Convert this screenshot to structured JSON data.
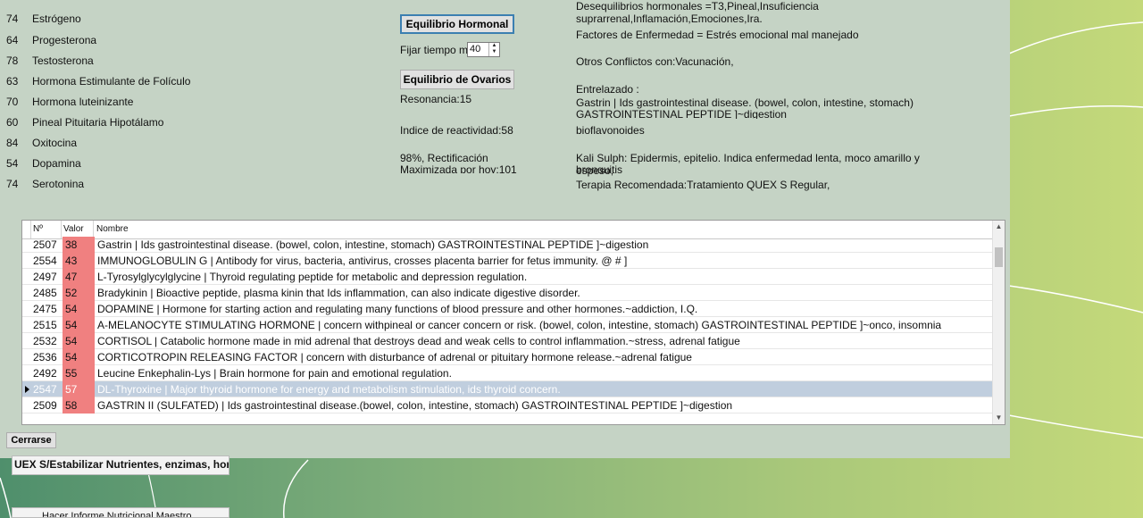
{
  "hormones": [
    {
      "value": "74",
      "name": "Estrógeno"
    },
    {
      "value": "64",
      "name": "Progesterona"
    },
    {
      "value": "78",
      "name": "Testosterona"
    },
    {
      "value": "63",
      "name": "Hormona Estimulante de Folículo"
    },
    {
      "value": "70",
      "name": "Hormona luteinizante"
    },
    {
      "value": "60",
      "name": "Pineal Pituitaria Hipotálamo"
    },
    {
      "value": "84",
      "name": "Oxitocina"
    },
    {
      "value": "54",
      "name": "Dopamina"
    },
    {
      "value": "74",
      "name": "Serotonina"
    }
  ],
  "controls": {
    "equilibrio_hormonal": "Equilibrio Hormonal",
    "fijar_tiempo_label": "Fijar tiempo mi",
    "fijar_tiempo_value": "40",
    "equilibrio_ovarios": "Equilibrio de Ovarios",
    "resonancia": "Resonancia:15",
    "indice": "Indice de reactividad:58",
    "rectificacion_1": "98%, Rectificación",
    "rectificacion_2": "Maximizada por hoy:101"
  },
  "info": {
    "desequilibrios_1": "Desequilibrios hormonales =T3,Pineal,Insuficiencia",
    "desequilibrios_2": "suprarrenal,Inflamación,Emociones,Ira.",
    "factores": "Factores de Enfermedad = Estrés emocional mal manejado",
    "otros": "Otros Conflictos con:Vacunación,",
    "entrelazado": "Entrelazado :",
    "entrelazado_1": "Gastrin | Ids gastrointestinal disease. (bowel, colon, intestine, stomach)",
    "entrelazado_2": "GASTROINTESTINAL PEPTIDE  ]~digestion",
    "bioflavonoides": "bioflavonoides",
    "kali_1": "Kali Sulph: Epidermis, epitelio. Indica enfermedad lenta, moco amarillo y espeso,",
    "kali_2": "bronquitis",
    "terapia": "Terapia Recomendada:Tratamiento QUEX S Regular,"
  },
  "grid": {
    "headers": {
      "no": "Nº",
      "valor": "Valor",
      "nombre": "Nombre"
    },
    "rows": [
      {
        "no": "2507",
        "valor": "38",
        "nombre": "Gastrin | Ids gastrointestinal disease. (bowel, colon, intestine, stomach) GASTROINTESTINAL PEPTIDE  ]~digestion"
      },
      {
        "no": "2554",
        "valor": "43",
        "nombre": "IMMUNOGLOBULIN G | Antibody for virus, bacteria, antivirus, crosses placenta barrier for fetus immunity. @ # ]"
      },
      {
        "no": "2497",
        "valor": "47",
        "nombre": "L-Tyrosylglycylglycine | Thyroid regulating peptide for metabolic and depression regulation."
      },
      {
        "no": "2485",
        "valor": "52",
        "nombre": "Bradykinin | Bioactive peptide, plasma kinin that Ids inflammation, can also indicate digestive disorder."
      },
      {
        "no": "2475",
        "valor": "54",
        "nombre": "DOPAMINE | Hormone for starting action and regulating many functions of blood pressure and other hormones.~addiction, I.Q."
      },
      {
        "no": "2515",
        "valor": "54",
        "nombre": "A-MELANOCYTE STIMULATING HORMONE | concern withpineal or cancer concern or risk. (bowel, colon, intestine, stomach) GASTROINTESTINAL PEPTIDE  ]~onco, insomnia"
      },
      {
        "no": "2532",
        "valor": "54",
        "nombre": "CORTISOL | Catabolic hormone made in mid adrenal that destroys dead and weak cells to control inflammation.~stress, adrenal fatigue"
      },
      {
        "no": "2536",
        "valor": "54",
        "nombre": "CORTICOTROPIN RELEASING FACTOR | concern with disturbance of adrenal or pituitary hormone release.~adrenal fatigue"
      },
      {
        "no": "2492",
        "valor": "55",
        "nombre": "Leucine Enkephalin-Lys | Brain hormone for pain and emotional regulation."
      },
      {
        "no": "2547",
        "valor": "57",
        "nombre": "DL-Thyroxine | Major thyroid hormone for energy and metabolism stimulation, ids thyroid concern.",
        "selected": true
      },
      {
        "no": "2509",
        "valor": "58",
        "nombre": "GASTRIN II (SULFATED) | Ids gastrointestinal disease.(bowel, colon, intestine, stomach) GASTROINTESTINAL PEPTIDE  ]~digestion"
      }
    ]
  },
  "cerrarse": "Cerrarse",
  "background_buttons": {
    "estabilizar": "UEX S/Estabilizar Nutrientes, enzimas, hormona",
    "informe": "Hacer Informe Nutricional Maestro"
  }
}
